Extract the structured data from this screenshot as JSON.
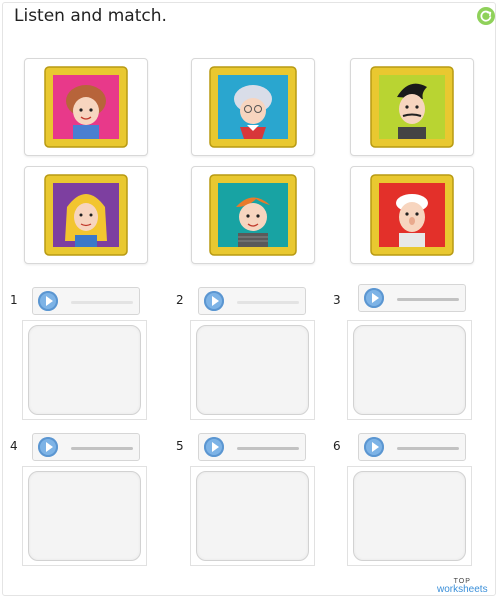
{
  "title": "Listen and match.",
  "colors": {
    "accent": "#7db3e6",
    "refresh": "#8fd15a",
    "brand": "#3a8fd9"
  },
  "pictures": [
    {
      "name": "girl-portrait",
      "bg": "#e8398a",
      "hair": "#b7643a",
      "skin": "#f7d5bf"
    },
    {
      "name": "grandma-portrait",
      "bg": "#2aa6cf",
      "hair": "#d9dde8",
      "skin": "#f7d5bf"
    },
    {
      "name": "man-portrait",
      "bg": "#b9d432",
      "hair": "#1a1a1a",
      "skin": "#f7d5bf"
    },
    {
      "name": "woman-portrait",
      "bg": "#7d3fa0",
      "hair": "#f2c52f",
      "skin": "#f7d5bf"
    },
    {
      "name": "boy-portrait",
      "bg": "#18a3a3",
      "hair": "#e97a2b",
      "skin": "#f7d5bf"
    },
    {
      "name": "grandpa-portrait",
      "bg": "#e3302a",
      "hair": "#ffffff",
      "skin": "#f7d5bf"
    }
  ],
  "numbers": [
    "1",
    "2",
    "3",
    "4",
    "5",
    "6"
  ],
  "footer": {
    "top": "TOP",
    "brand": "worksheets"
  }
}
